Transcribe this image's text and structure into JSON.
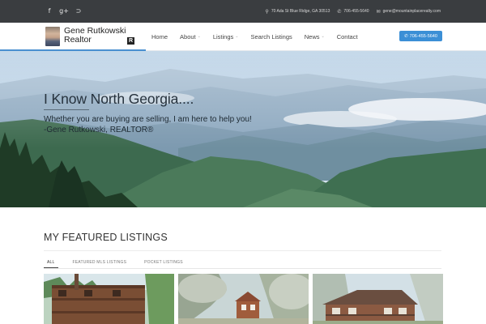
{
  "topbar": {
    "social": [
      {
        "icon": "facebook-icon",
        "glyph": "f"
      },
      {
        "icon": "google-plus-icon",
        "glyph": "g+"
      },
      {
        "icon": "rss-icon",
        "glyph": "⊃"
      }
    ],
    "address": "70 Ada St Blue Ridge, GA 30513",
    "phone": "706-455-5640",
    "email": "gene@mountainplacerealty.com"
  },
  "brand": {
    "name_line1": "Gene Rutkowski",
    "name_line2": "Realtor",
    "realtor_mark": "R"
  },
  "nav": {
    "items": [
      {
        "label": "Home",
        "has_dropdown": false
      },
      {
        "label": "About",
        "has_dropdown": true
      },
      {
        "label": "Listings",
        "has_dropdown": true
      },
      {
        "label": "Search Listings",
        "has_dropdown": false
      },
      {
        "label": "News",
        "has_dropdown": true
      },
      {
        "label": "Contact",
        "has_dropdown": false
      }
    ],
    "phone_button": "706-455-5640"
  },
  "hero": {
    "title": "I Know North Georgia....",
    "subtitle_line1": "Whether you are buying are selling, I am here to help you!",
    "subtitle_line2": "-Gene Rutkowski, REALTOR®"
  },
  "featured": {
    "title": "MY FEATURED LISTINGS",
    "tabs": [
      "ALL",
      "FEATURED MLS LISTINGS",
      "POCKET LISTINGS"
    ],
    "active_tab": "ALL"
  },
  "colors": {
    "topbar": "#3a3d40",
    "accent": "#3b8fd6"
  }
}
